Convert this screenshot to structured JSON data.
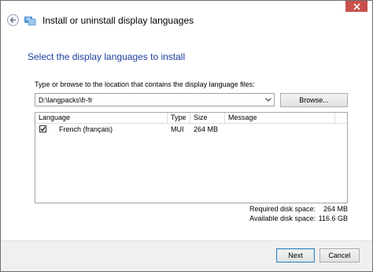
{
  "window": {
    "title": "Install or uninstall display languages"
  },
  "main": {
    "heading": "Select the display languages to install",
    "prompt": "Type or browse to the location that contains the display language files:",
    "path_value": "D:\\langpacks\\fr-fr",
    "browse_label": "Browse..."
  },
  "list": {
    "columns": [
      "Language",
      "Type",
      "Size",
      "Message"
    ],
    "rows": [
      {
        "checked": true,
        "language": "French (français)",
        "type": "MUI",
        "size": "264 MB",
        "message": ""
      }
    ]
  },
  "disk": {
    "required_label": "Required disk space:",
    "required_value": "264 MB",
    "available_label": "Available disk space:",
    "available_value": "116.6 GB"
  },
  "footer": {
    "next_label": "Next",
    "cancel_label": "Cancel"
  },
  "colors": {
    "heading": "#1e3f9e",
    "close_button": "#c7504b"
  },
  "icons": [
    "close-icon",
    "back-arrow-icon",
    "language-app-icon",
    "dropdown-arrow-icon",
    "checkmark-icon"
  ]
}
